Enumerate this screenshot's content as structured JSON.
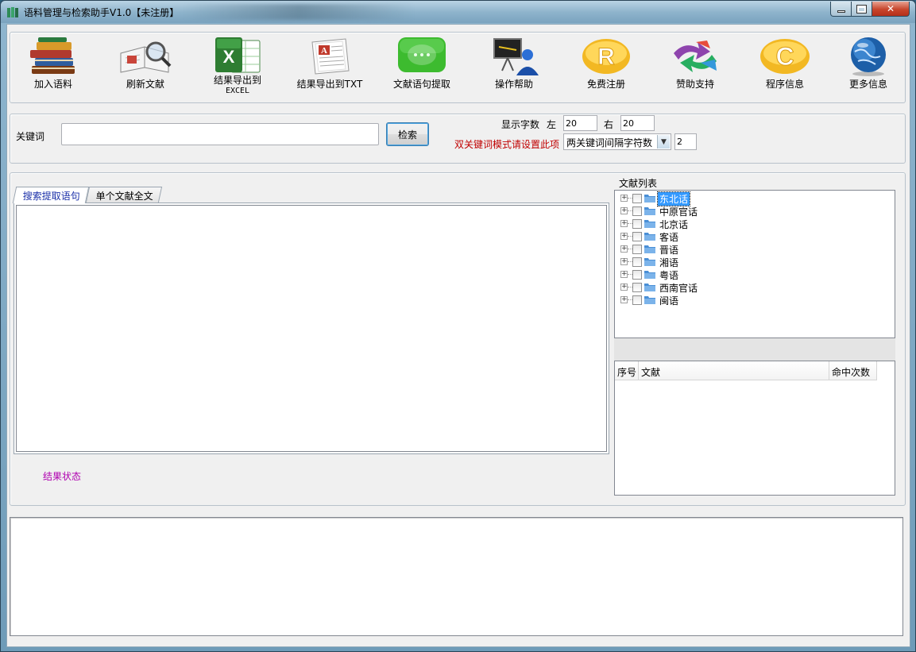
{
  "window": {
    "title": "语料管理与检索助手V1.0【未注册】",
    "close_label": "✕"
  },
  "toolbar": {
    "buttons": [
      {
        "label": "加入语料",
        "icon": "books-icon"
      },
      {
        "label": "刷新文献",
        "icon": "book-magnifier-icon"
      },
      {
        "label": "结果导出到",
        "sub": "EXCEL",
        "icon": "excel-icon"
      },
      {
        "label": "结果导出到TXT",
        "icon": "document-icon"
      },
      {
        "label": "文献语句提取",
        "icon": "chat-bubble-icon"
      },
      {
        "label": "操作帮助",
        "icon": "presenter-icon"
      },
      {
        "label": "免费注册",
        "icon": "registered-icon"
      },
      {
        "label": "赞助支持",
        "icon": "arrows-icon"
      },
      {
        "label": "程序信息",
        "icon": "copyright-icon"
      },
      {
        "label": "更多信息",
        "icon": "globe-icon"
      }
    ]
  },
  "search": {
    "keyword_label": "关键词",
    "keyword_value": "",
    "search_button": "检索",
    "display_chars_label": "显示字数",
    "left_label": "左",
    "left_value": "20",
    "right_label": "右",
    "right_value": "20",
    "dual_mode_note": "双关键词模式请设置此项",
    "interval_select": "两关键词间隔字符数",
    "interval_value": "2"
  },
  "tabs": [
    {
      "label": "搜索提取语句",
      "active": true
    },
    {
      "label": "单个文献全文",
      "active": false
    }
  ],
  "status_text": "结果状态",
  "doc_list": {
    "title": "文献列表",
    "items": [
      "东北话",
      "中原官话",
      "北京话",
      "客语",
      "晋语",
      "湘语",
      "粤语",
      "西南官话",
      "闽语"
    ],
    "selected_index": 0
  },
  "results_table": {
    "columns": [
      "序号",
      "文献",
      "命中次数"
    ]
  },
  "colors": {
    "status": "#b000b0",
    "note": "#c00000",
    "selection": "#3399ff"
  }
}
